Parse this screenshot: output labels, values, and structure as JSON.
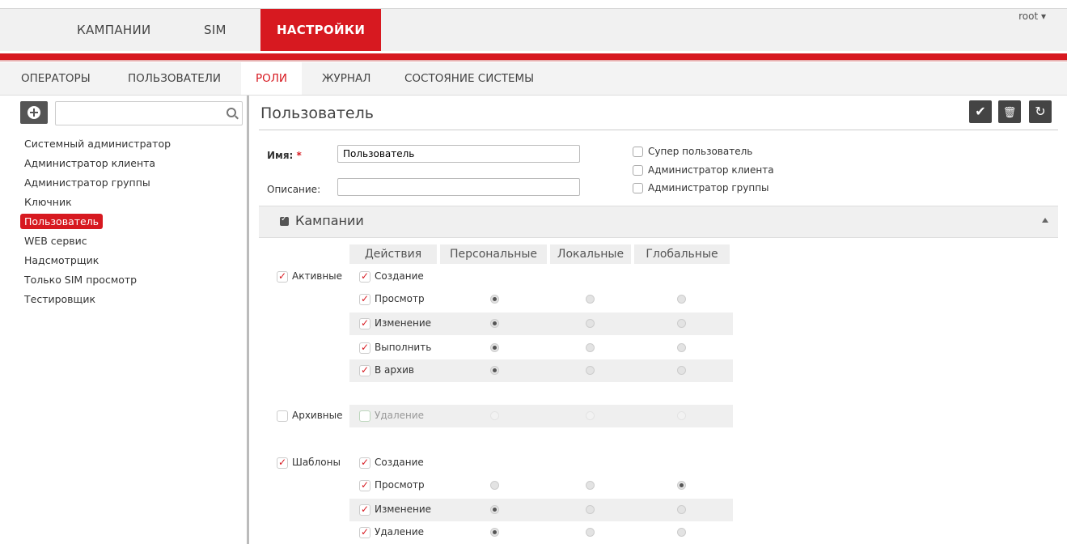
{
  "topnav": {
    "items": [
      {
        "label": "КАМПАНИИ"
      },
      {
        "label": "SIM"
      },
      {
        "label": "НАСТРОЙКИ"
      }
    ],
    "user": "root ▾"
  },
  "subnav": {
    "items": [
      {
        "label": "ОПЕРАТОРЫ"
      },
      {
        "label": "ПОЛЬЗОВАТЕЛИ"
      },
      {
        "label": "РОЛИ"
      },
      {
        "label": "ЖУРНАЛ"
      },
      {
        "label": "СОСТОЯНИЕ СИСТЕМЫ"
      }
    ]
  },
  "sidebar": {
    "search_value": "",
    "roles": [
      "Системный администратор",
      "Администратор клиента",
      "Администратор группы",
      "Ключник",
      "Пользователь",
      "WEB сервис",
      "Надсмотрщик",
      "Только SIM просмотр",
      "Тестировщик"
    ]
  },
  "main": {
    "title": "Пользователь",
    "toolbar": {
      "save": "✔",
      "delete": "🗑",
      "undo": "↻"
    },
    "form": {
      "name_label": "Имя:",
      "name_required": "*",
      "name_value": "Пользователь",
      "description_label": "Описание:",
      "description_value": "",
      "flags": [
        "Супер пользователь",
        "Администратор клиента",
        "Администратор группы"
      ]
    },
    "section": {
      "title": "Кампании"
    },
    "columns": [
      "Действия",
      "Персональные",
      "Локальные",
      "Глобальные"
    ],
    "rows": [
      {
        "group": "Активные",
        "action": "Создание"
      },
      {
        "group": "",
        "action": "Просмотр"
      },
      {
        "group": "",
        "action": "Изменение"
      },
      {
        "group": "",
        "action": "Выполнить"
      },
      {
        "group": "",
        "action": "В архив"
      },
      {
        "group": "Архивные",
        "action": "Удаление"
      },
      {
        "group": "Шаблоны",
        "action": "Создание"
      },
      {
        "group": "",
        "action": "Просмотр"
      },
      {
        "group": "",
        "action": "Изменение"
      },
      {
        "group": "",
        "action": "Удаление"
      }
    ]
  }
}
